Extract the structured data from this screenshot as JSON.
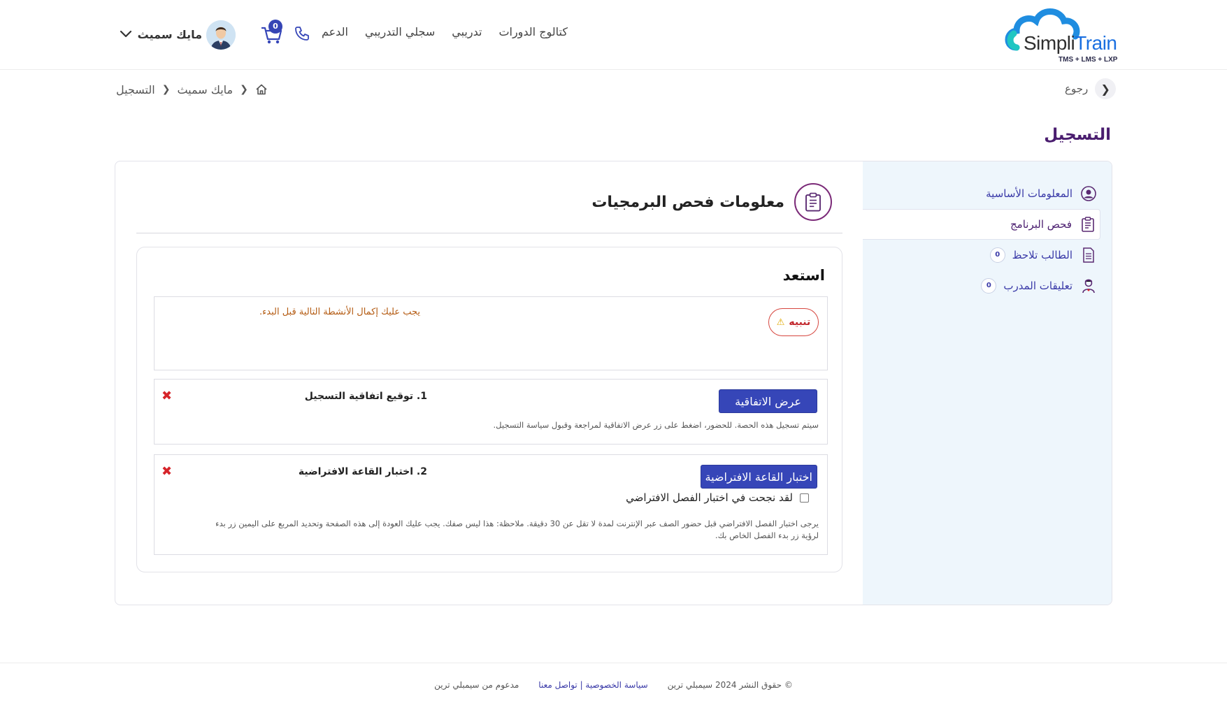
{
  "brand": {
    "name_part1": "Simpli",
    "name_part2": "Train",
    "tagline": "TMS + LMS + LXP",
    "accent": "#3646b8",
    "title_color": "#4a1d6f"
  },
  "nav": {
    "items": [
      "كتالوج الدورات",
      "تدريبي",
      "سجلي التدريبي",
      "الدعم"
    ]
  },
  "header": {
    "cart_count": "0",
    "user_name": "مايك سميث",
    "icons": [
      "phone-icon",
      "cart-icon",
      "chevron-down-icon"
    ]
  },
  "breadcrumb": {
    "items": [
      "مايك سميث",
      "التسجيل"
    ],
    "back_label": "رجوع"
  },
  "page": {
    "title": "التسجيل"
  },
  "sidebar": {
    "items": [
      {
        "label": "المعلومات الأساسية",
        "icon": "user-circle-icon"
      },
      {
        "label": "فحص البرنامج",
        "icon": "clipboard-icon"
      },
      {
        "label": "الطالب تلاحظ",
        "icon": "document-icon",
        "count": "0"
      },
      {
        "label": "تعليقات المدرب",
        "icon": "trainer-icon",
        "count": "0"
      }
    ]
  },
  "section": {
    "title": "معلومات فحص البرمجيات",
    "ready_title": "استعد",
    "alert_label": "تنبيه",
    "alert_text": "يجب عليك إكمال الأنشطة التالية قبل البدء."
  },
  "requirements": [
    {
      "label": "1. توقيع اتفاقية التسجيل",
      "button": "عرض الاتفاقية",
      "description": "سيتم تسجيل هذه الحصة. للحضور، اضغط على زر عرض الاتفاقية لمراجعة وقبول سياسة التسجيل."
    },
    {
      "label": "2. اختبار القاعة الافتراضية",
      "button": "اختبار القاعة الافتراضية",
      "checkbox_label": "لقد نجحت في اختبار الفصل الافتراضي",
      "description": "يرجى اختبار الفصل الافتراضي قبل حضور الصف عبر الإنترنت لمدة لا تقل عن 30 دقيقة. ملاحظة: هذا ليس صفك. يجب عليك العودة إلى هذه الصفحة وتحديد المربع على اليمين زر بدء لرؤية زر بدء الفصل الخاص بك."
    }
  ],
  "footer": {
    "copyright": "© حقوق النشر 2024 سيمبلي ترين",
    "links": "سياسة الخصوصية | تواصل معنا",
    "powered": "مدعوم من سيمبلي ترين"
  }
}
